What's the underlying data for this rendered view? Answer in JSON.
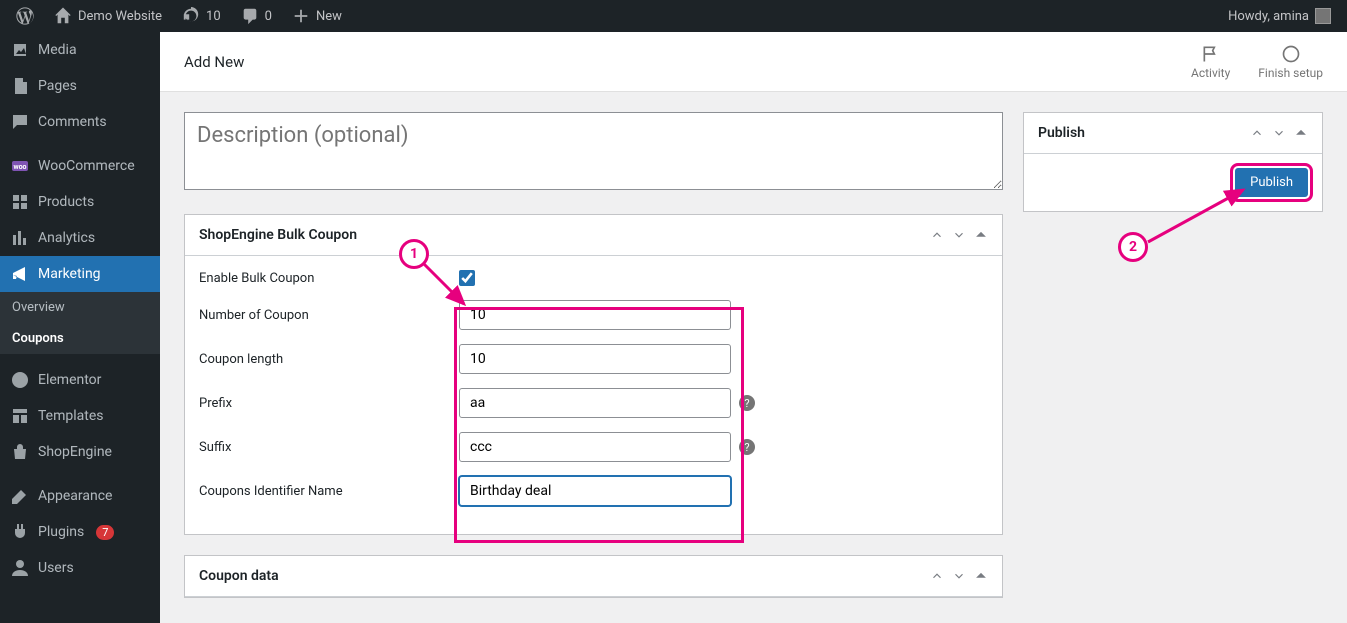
{
  "adminbar": {
    "site_name": "Demo Website",
    "updates_count": "10",
    "comments_count": "0",
    "new_label": "New",
    "howdy": "Howdy, amina"
  },
  "sidebar": {
    "media": "Media",
    "pages": "Pages",
    "comments": "Comments",
    "woocommerce": "WooCommerce",
    "products": "Products",
    "analytics": "Analytics",
    "marketing": "Marketing",
    "overview": "Overview",
    "coupons": "Coupons",
    "elementor": "Elementor",
    "templates": "Templates",
    "shopengine": "ShopEngine",
    "appearance": "Appearance",
    "plugins": "Plugins",
    "plugins_badge": "7",
    "users": "Users"
  },
  "topstrip": {
    "title": "Add New",
    "activity": "Activity",
    "finish": "Finish setup"
  },
  "desc_placeholder": "Description (optional)",
  "bulk_panel": {
    "title": "ShopEngine Bulk Coupon",
    "enable_label": "Enable Bulk Coupon",
    "enable_checked": true,
    "number_label": "Number of Coupon",
    "number_value": "10",
    "length_label": "Coupon length",
    "length_value": "10",
    "prefix_label": "Prefix",
    "prefix_value": "aa",
    "suffix_label": "Suffix",
    "suffix_value": "ccc",
    "identifier_label": "Coupons Identifier Name",
    "identifier_value": "Birthday deal"
  },
  "coupon_data_panel": {
    "title": "Coupon data"
  },
  "publish_panel": {
    "title": "Publish",
    "button": "Publish"
  },
  "annotations": {
    "step1": "1",
    "step2": "2"
  }
}
